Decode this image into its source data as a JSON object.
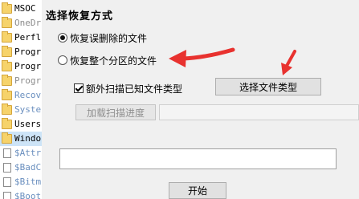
{
  "background_list": {
    "items": [
      {
        "text": "MSOC",
        "icon": "folder-icon",
        "style": "normal"
      },
      {
        "text": "OneDr",
        "icon": "folder-icon",
        "style": "gray"
      },
      {
        "text": "Perfl",
        "icon": "folder-icon",
        "style": "normal"
      },
      {
        "text": "Progr",
        "icon": "folder-icon",
        "style": "normal"
      },
      {
        "text": "Progr",
        "icon": "folder-icon",
        "style": "normal"
      },
      {
        "text": "Progr",
        "icon": "folder-icon",
        "style": "gray"
      },
      {
        "text": "Recov",
        "icon": "folder-icon",
        "style": "blue"
      },
      {
        "text": "Syste",
        "icon": "folder-icon",
        "style": "blue"
      },
      {
        "text": "Users",
        "icon": "folder-icon",
        "style": "normal"
      },
      {
        "text": "Windo",
        "icon": "folder-icon",
        "style": "selected"
      },
      {
        "text": "$Attr",
        "icon": "file-icon",
        "style": "blue"
      },
      {
        "text": "$BadC",
        "icon": "file-icon",
        "style": "blue"
      },
      {
        "text": "$Bitm",
        "icon": "file-icon",
        "style": "blue"
      },
      {
        "text": "$Boot",
        "icon": "file-icon",
        "style": "blue"
      }
    ]
  },
  "dialog": {
    "title": "选择恢复方式",
    "options": [
      {
        "label": "恢复误删除的文件",
        "checked": true
      },
      {
        "label": "恢复整个分区的文件",
        "checked": false
      }
    ],
    "extra_scan_checkbox": {
      "label": "额外扫描已知文件类型",
      "checked": true
    },
    "select_file_type_button": "选择文件类型",
    "load_progress_button": "加载扫描进度",
    "progress_path_value": "",
    "path_input_value": "",
    "start_button": "开始"
  },
  "annotation_color": "#e8322f"
}
